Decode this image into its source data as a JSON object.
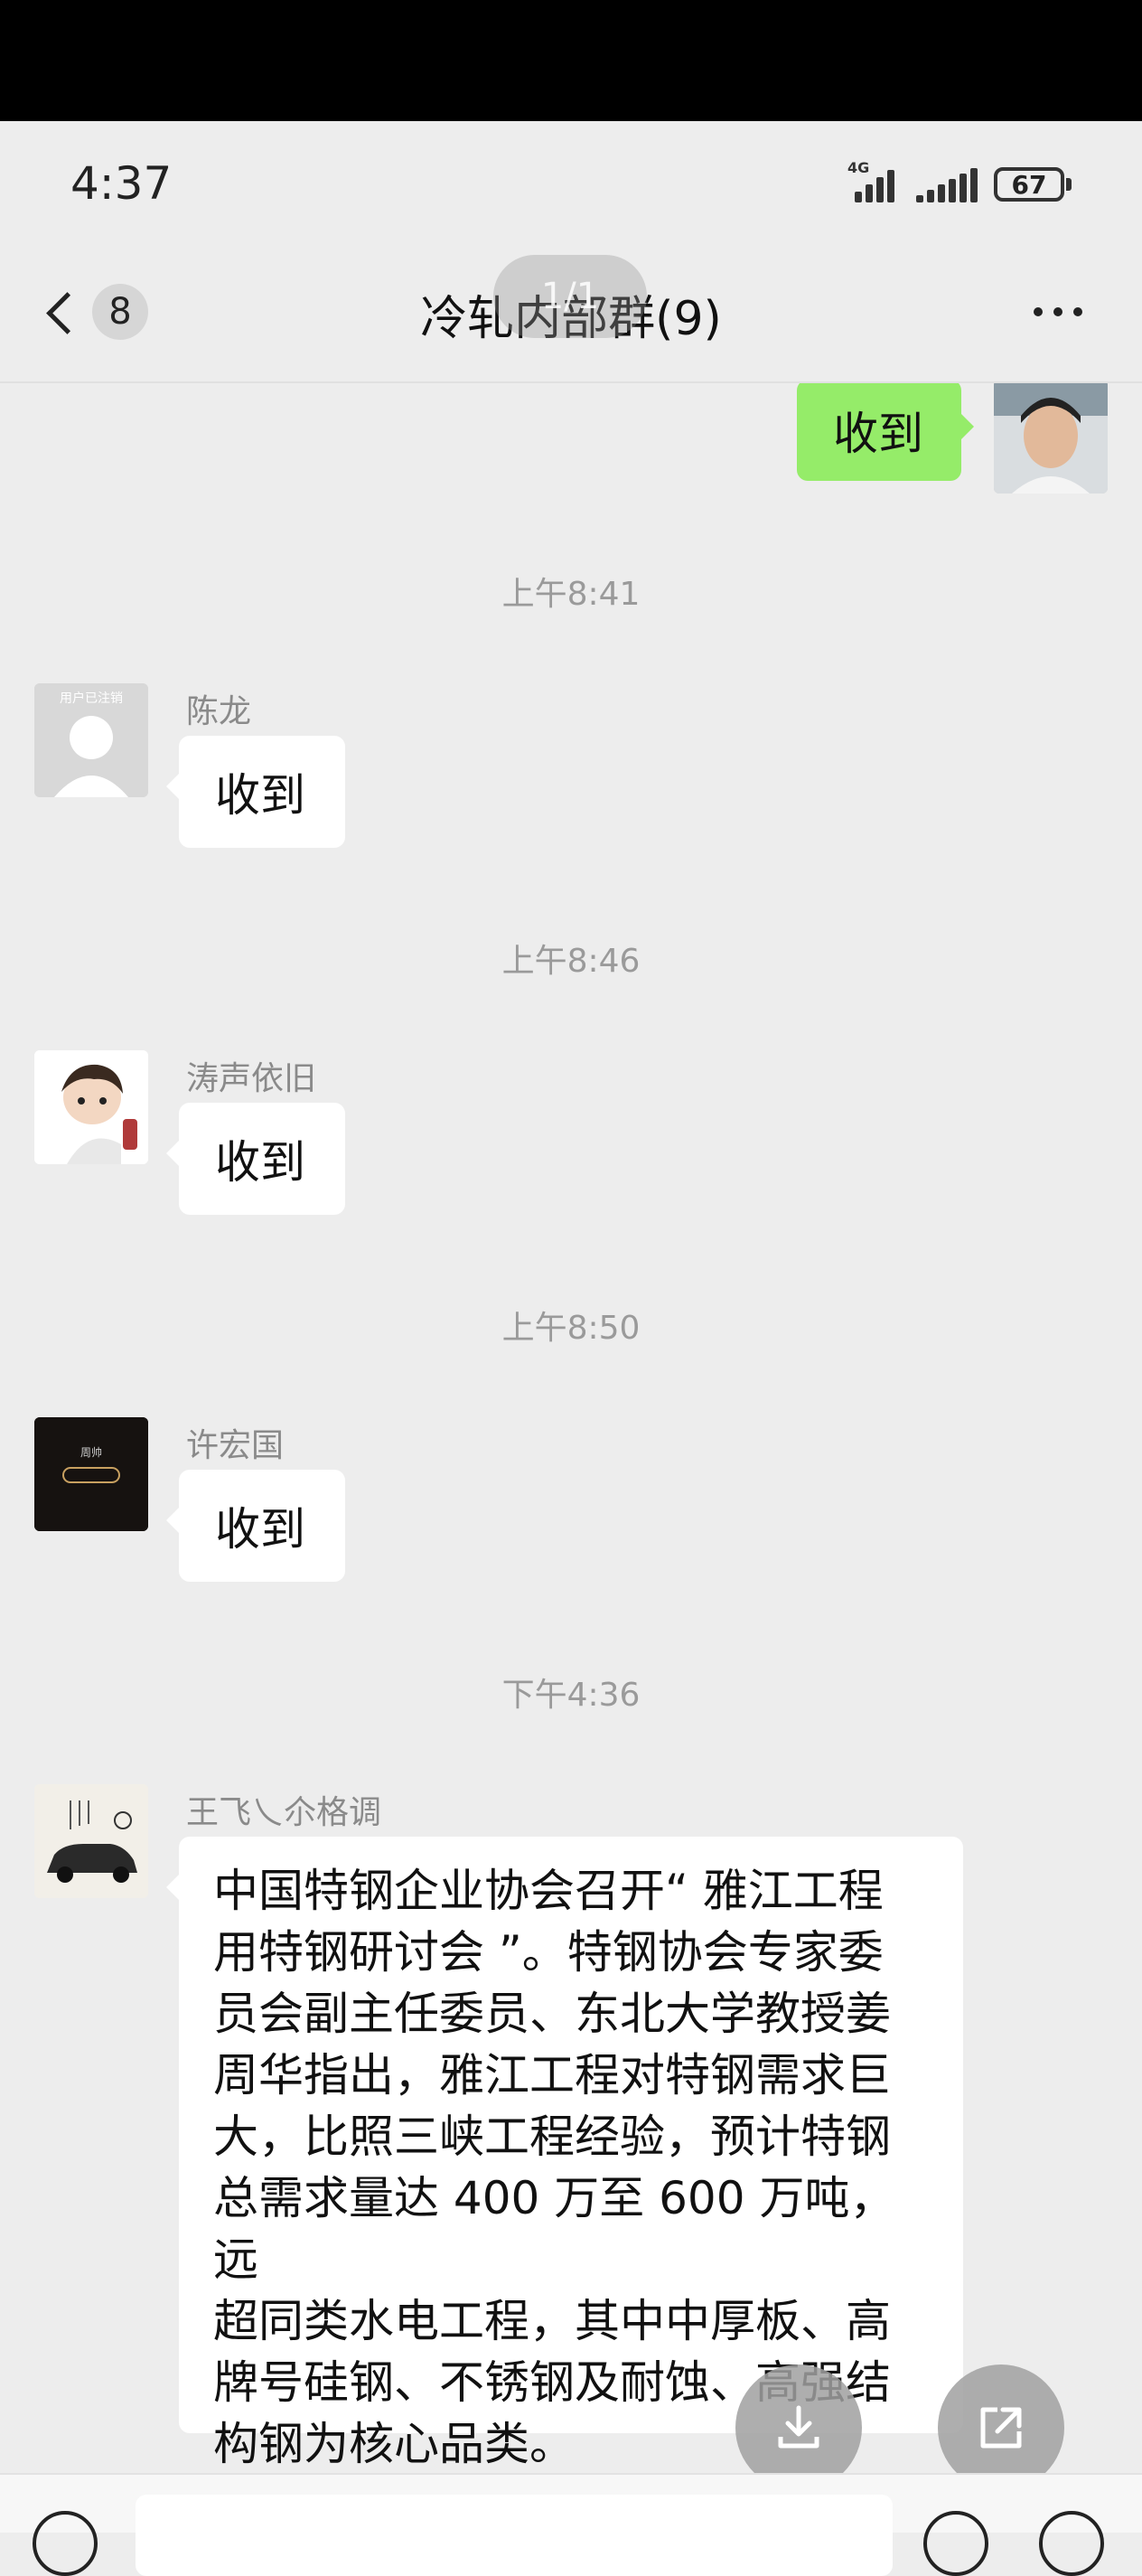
{
  "status_bar": {
    "time": "4:37",
    "network": "4G",
    "battery": "67"
  },
  "header": {
    "unread_count": "8",
    "title": "冷轧内部群(9)",
    "image_pager": "1/1"
  },
  "messages": [
    {
      "type": "outgoing",
      "text": "收到"
    },
    {
      "type": "timestamp",
      "text": "上午8:41"
    },
    {
      "type": "incoming",
      "sender": "陈龙",
      "avatar_caption": "用户已注销",
      "text": "收到"
    },
    {
      "type": "timestamp",
      "text": "上午8:46"
    },
    {
      "type": "incoming",
      "sender": "涛声依旧",
      "text": "收到"
    },
    {
      "type": "timestamp",
      "text": "上午8:50"
    },
    {
      "type": "incoming",
      "sender": "许宏国",
      "avatar_caption": "周帅",
      "text": "收到"
    },
    {
      "type": "timestamp",
      "text": "下午4:36"
    },
    {
      "type": "incoming",
      "sender": "王飞乀尒格调",
      "lines": [
        "中国特钢企业协会召开“ 雅江工程",
        "用特钢研讨会 ”。特钢协会专家委",
        "员会副主任委员、东北大学教授姜",
        "周华指出，雅江工程对特钢需求巨",
        "大，比照三峡工程经验，预计特钢",
        "总需求量达 400 万至 600 万吨，远",
        "超同类水电工程，其中中厚板、高",
        "牌号硅钢、不锈钢及耐蚀、高强结",
        "构钢为核心品类。"
      ]
    }
  ],
  "icons": {
    "back": "chevron-left-icon",
    "more": "more-dots-icon",
    "download": "download-icon",
    "share": "share-icon"
  },
  "colors": {
    "outgoing_bubble": "#95ec69",
    "incoming_bubble": "#ffffff",
    "background": "#ededed"
  }
}
